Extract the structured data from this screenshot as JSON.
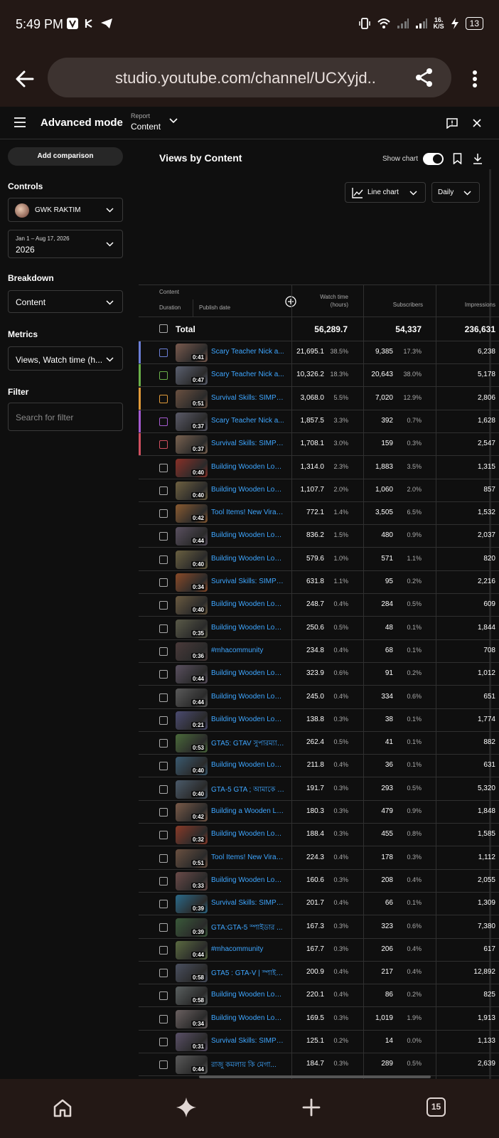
{
  "status": {
    "time": "5:49 PM",
    "net_speed_value": "16.",
    "net_speed_unit": "K/S",
    "battery": "13"
  },
  "browser": {
    "url": "studio.youtube.com/channel/UCXyjd.."
  },
  "header": {
    "mode_title": "Advanced mode",
    "report_label": "Report",
    "report_value": "Content"
  },
  "sidebar": {
    "add_comparison": "Add comparison",
    "controls_label": "Controls",
    "channel_name": "GWK RAKTIM",
    "date_range_label": "Jan 1 – Aug 17, 2026",
    "date_range_value": "2026",
    "breakdown_label": "Breakdown",
    "breakdown_value": "Content",
    "metrics_label": "Metrics",
    "metrics_value": "Views, Watch time (h...",
    "filter_label": "Filter",
    "filter_placeholder": "Search for filter"
  },
  "main": {
    "title": "Views by Content",
    "show_chart_label": "Show chart",
    "chart_type": "Line chart",
    "interval": "Daily"
  },
  "table": {
    "header": {
      "content": "Content",
      "duration": "Duration",
      "publish_date": "Publish date",
      "watch_time_line1": "Watch time",
      "watch_time_line2": "(hours)",
      "subscribers": "Subscribers",
      "impressions": "Impressions"
    },
    "total": {
      "label": "Total",
      "watch_time": "56,289.7",
      "subscribers": "54,337",
      "impressions": "236,631"
    },
    "rows": [
      {
        "dur": "0:41",
        "title": "Scary Teacher Nick a...",
        "wt": "21,695.1",
        "wtp": "38.5%",
        "sub": "9,385",
        "subp": "17.3%",
        "imp": "6,238",
        "accent": "#6b7fd6",
        "box": "#6b7fd6",
        "thumb": "#7a5a4e"
      },
      {
        "dur": "0:47",
        "title": "Scary Teacher Nick a...",
        "wt": "10,326.2",
        "wtp": "18.3%",
        "sub": "20,643",
        "subp": "38.0%",
        "imp": "5,178",
        "accent": "#6bb04a",
        "box": "#6bb04a",
        "thumb": "#5b6070"
      },
      {
        "dur": "0:51",
        "title": "Survival Skills: SIMPL...",
        "wt": "3,068.0",
        "wtp": "5.5%",
        "sub": "7,020",
        "subp": "12.9%",
        "imp": "2,806",
        "accent": "#e09a3a",
        "box": "#e09a3a",
        "thumb": "#6a5040"
      },
      {
        "dur": "0:37",
        "title": "Scary Teacher Nick a...",
        "wt": "1,857.5",
        "wtp": "3.3%",
        "sub": "392",
        "subp": "0.7%",
        "imp": "1,628",
        "accent": "#a55bd0",
        "box": "#a55bd0",
        "thumb": "#5a5a68"
      },
      {
        "dur": "0:37",
        "title": "Survival Skills: SIMPL...",
        "wt": "1,708.1",
        "wtp": "3.0%",
        "sub": "159",
        "subp": "0.3%",
        "imp": "2,547",
        "accent": "#d05060",
        "box": "#d05060",
        "thumb": "#7a6250"
      },
      {
        "dur": "0:40",
        "title": "Building Wooden Log ...",
        "wt": "1,314.0",
        "wtp": "2.3%",
        "sub": "1,883",
        "subp": "3.5%",
        "imp": "1,315",
        "accent": "",
        "box": "",
        "thumb": "#8a3028"
      },
      {
        "dur": "0:40",
        "title": "Building Wooden Log ...",
        "wt": "1,107.7",
        "wtp": "2.0%",
        "sub": "1,060",
        "subp": "2.0%",
        "imp": "857",
        "accent": "",
        "box": "",
        "thumb": "#6e6040"
      },
      {
        "dur": "0:42",
        "title": "Tool Items! New Viral ...",
        "wt": "772.1",
        "wtp": "1.4%",
        "sub": "3,505",
        "subp": "6.5%",
        "imp": "1,532",
        "accent": "",
        "box": "",
        "thumb": "#8a5a30"
      },
      {
        "dur": "0:44",
        "title": "Building Wooden Log ...",
        "wt": "836.2",
        "wtp": "1.5%",
        "sub": "480",
        "subp": "0.9%",
        "imp": "2,037",
        "accent": "",
        "box": "",
        "thumb": "#5a5060"
      },
      {
        "dur": "0:40",
        "title": "Building Wooden Log ...",
        "wt": "579.6",
        "wtp": "1.0%",
        "sub": "571",
        "subp": "1.1%",
        "imp": "820",
        "accent": "",
        "box": "",
        "thumb": "#6a6040"
      },
      {
        "dur": "0:34",
        "title": "Survival Skills: SIMPL...",
        "wt": "631.8",
        "wtp": "1.1%",
        "sub": "95",
        "subp": "0.2%",
        "imp": "2,216",
        "accent": "",
        "box": "",
        "thumb": "#8a4a28"
      },
      {
        "dur": "0:40",
        "title": "Building Wooden Log ...",
        "wt": "248.7",
        "wtp": "0.4%",
        "sub": "284",
        "subp": "0.5%",
        "imp": "609",
        "accent": "",
        "box": "",
        "thumb": "#6a5a40"
      },
      {
        "dur": "0:35",
        "title": "Building Wooden Log ...",
        "wt": "250.6",
        "wtp": "0.5%",
        "sub": "48",
        "subp": "0.1%",
        "imp": "1,844",
        "accent": "",
        "box": "",
        "thumb": "#5a5a48"
      },
      {
        "dur": "0:36",
        "title": "#mhacommunity",
        "wt": "234.8",
        "wtp": "0.4%",
        "sub": "68",
        "subp": "0.1%",
        "imp": "708",
        "accent": "",
        "box": "",
        "thumb": "#4a3a3a"
      },
      {
        "dur": "0:44",
        "title": "Building Wooden Log ...",
        "wt": "323.9",
        "wtp": "0.6%",
        "sub": "91",
        "subp": "0.2%",
        "imp": "1,012",
        "accent": "",
        "box": "",
        "thumb": "#5a5060"
      },
      {
        "dur": "0:44",
        "title": "Building Wooden Log ...",
        "wt": "245.0",
        "wtp": "0.4%",
        "sub": "334",
        "subp": "0.6%",
        "imp": "651",
        "accent": "",
        "box": "",
        "thumb": "#5a5a5a"
      },
      {
        "dur": "0:21",
        "title": "Building Wooden Log ...",
        "wt": "138.8",
        "wtp": "0.3%",
        "sub": "38",
        "subp": "0.1%",
        "imp": "1,774",
        "accent": "",
        "box": "",
        "thumb": "#4a4a70"
      },
      {
        "dur": "0:53",
        "title": "GTA5: GTAV সুপারম্যান...",
        "wt": "262.4",
        "wtp": "0.5%",
        "sub": "41",
        "subp": "0.1%",
        "imp": "882",
        "accent": "",
        "box": "",
        "thumb": "#4a6a3a"
      },
      {
        "dur": "0:40",
        "title": "Building Wooden Log ...",
        "wt": "211.8",
        "wtp": "0.4%",
        "sub": "36",
        "subp": "0.1%",
        "imp": "631",
        "accent": "",
        "box": "",
        "thumb": "#3a5a70"
      },
      {
        "dur": "0:40",
        "title": "GTA-5 GTA ; আমাকে সু...",
        "wt": "191.7",
        "wtp": "0.3%",
        "sub": "293",
        "subp": "0.5%",
        "imp": "5,320",
        "accent": "",
        "box": "",
        "thumb": "#4a5a6a"
      },
      {
        "dur": "0:42",
        "title": "Building a Wooden Lo...",
        "wt": "180.3",
        "wtp": "0.3%",
        "sub": "479",
        "subp": "0.9%",
        "imp": "1,848",
        "accent": "",
        "box": "",
        "thumb": "#7a5a48"
      },
      {
        "dur": "0:32",
        "title": "Building Wooden Log ...",
        "wt": "188.4",
        "wtp": "0.3%",
        "sub": "455",
        "subp": "0.8%",
        "imp": "1,585",
        "accent": "",
        "box": "",
        "thumb": "#8a3a28"
      },
      {
        "dur": "0:51",
        "title": "Tool Items! New Viral ...",
        "wt": "224.3",
        "wtp": "0.4%",
        "sub": "178",
        "subp": "0.3%",
        "imp": "1,112",
        "accent": "",
        "box": "",
        "thumb": "#6a5040"
      },
      {
        "dur": "0:33",
        "title": "Building Wooden Log ...",
        "wt": "160.6",
        "wtp": "0.3%",
        "sub": "208",
        "subp": "0.4%",
        "imp": "2,055",
        "accent": "",
        "box": "",
        "thumb": "#6a4a48"
      },
      {
        "dur": "0:39",
        "title": "Survival Skills: SIMPL...",
        "wt": "201.7",
        "wtp": "0.4%",
        "sub": "66",
        "subp": "0.1%",
        "imp": "1,309",
        "accent": "",
        "box": "",
        "thumb": "#2a6a8a"
      },
      {
        "dur": "0:39",
        "title": "GTA:GTA-5 স্পাইডার ...",
        "wt": "167.3",
        "wtp": "0.3%",
        "sub": "323",
        "subp": "0.6%",
        "imp": "7,380",
        "accent": "",
        "box": "",
        "thumb": "#3a5a3a"
      },
      {
        "dur": "0:44",
        "title": "#mhacommunity",
        "wt": "167.7",
        "wtp": "0.3%",
        "sub": "206",
        "subp": "0.4%",
        "imp": "617",
        "accent": "",
        "box": "",
        "thumb": "#5a6a40"
      },
      {
        "dur": "0:58",
        "title": "GTA5 : GTA-V | স্পাইডা...",
        "wt": "200.9",
        "wtp": "0.4%",
        "sub": "217",
        "subp": "0.4%",
        "imp": "12,892",
        "accent": "",
        "box": "",
        "thumb": "#4a5060"
      },
      {
        "dur": "0:58",
        "title": "Building Wooden Log ...",
        "wt": "220.1",
        "wtp": "0.4%",
        "sub": "86",
        "subp": "0.2%",
        "imp": "825",
        "accent": "",
        "box": "",
        "thumb": "#5a6060"
      },
      {
        "dur": "0:34",
        "title": "Building Wooden Log ...",
        "wt": "169.5",
        "wtp": "0.3%",
        "sub": "1,019",
        "subp": "1.9%",
        "imp": "1,913",
        "accent": "",
        "box": "",
        "thumb": "#6a6060"
      },
      {
        "dur": "0:31",
        "title": "Survival Skills: SIMPL...",
        "wt": "125.1",
        "wtp": "0.2%",
        "sub": "14",
        "subp": "0.0%",
        "imp": "1,133",
        "accent": "",
        "box": "",
        "thumb": "#5a5068"
      },
      {
        "dur": "0:44",
        "title": "রাজু কমলায় কি মেগা...",
        "wt": "184.7",
        "wtp": "0.3%",
        "sub": "289",
        "subp": "0.5%",
        "imp": "2,639",
        "accent": "",
        "box": "",
        "thumb": "#5a5a5a"
      }
    ]
  },
  "bottom_nav": {
    "tab_count": "15"
  }
}
